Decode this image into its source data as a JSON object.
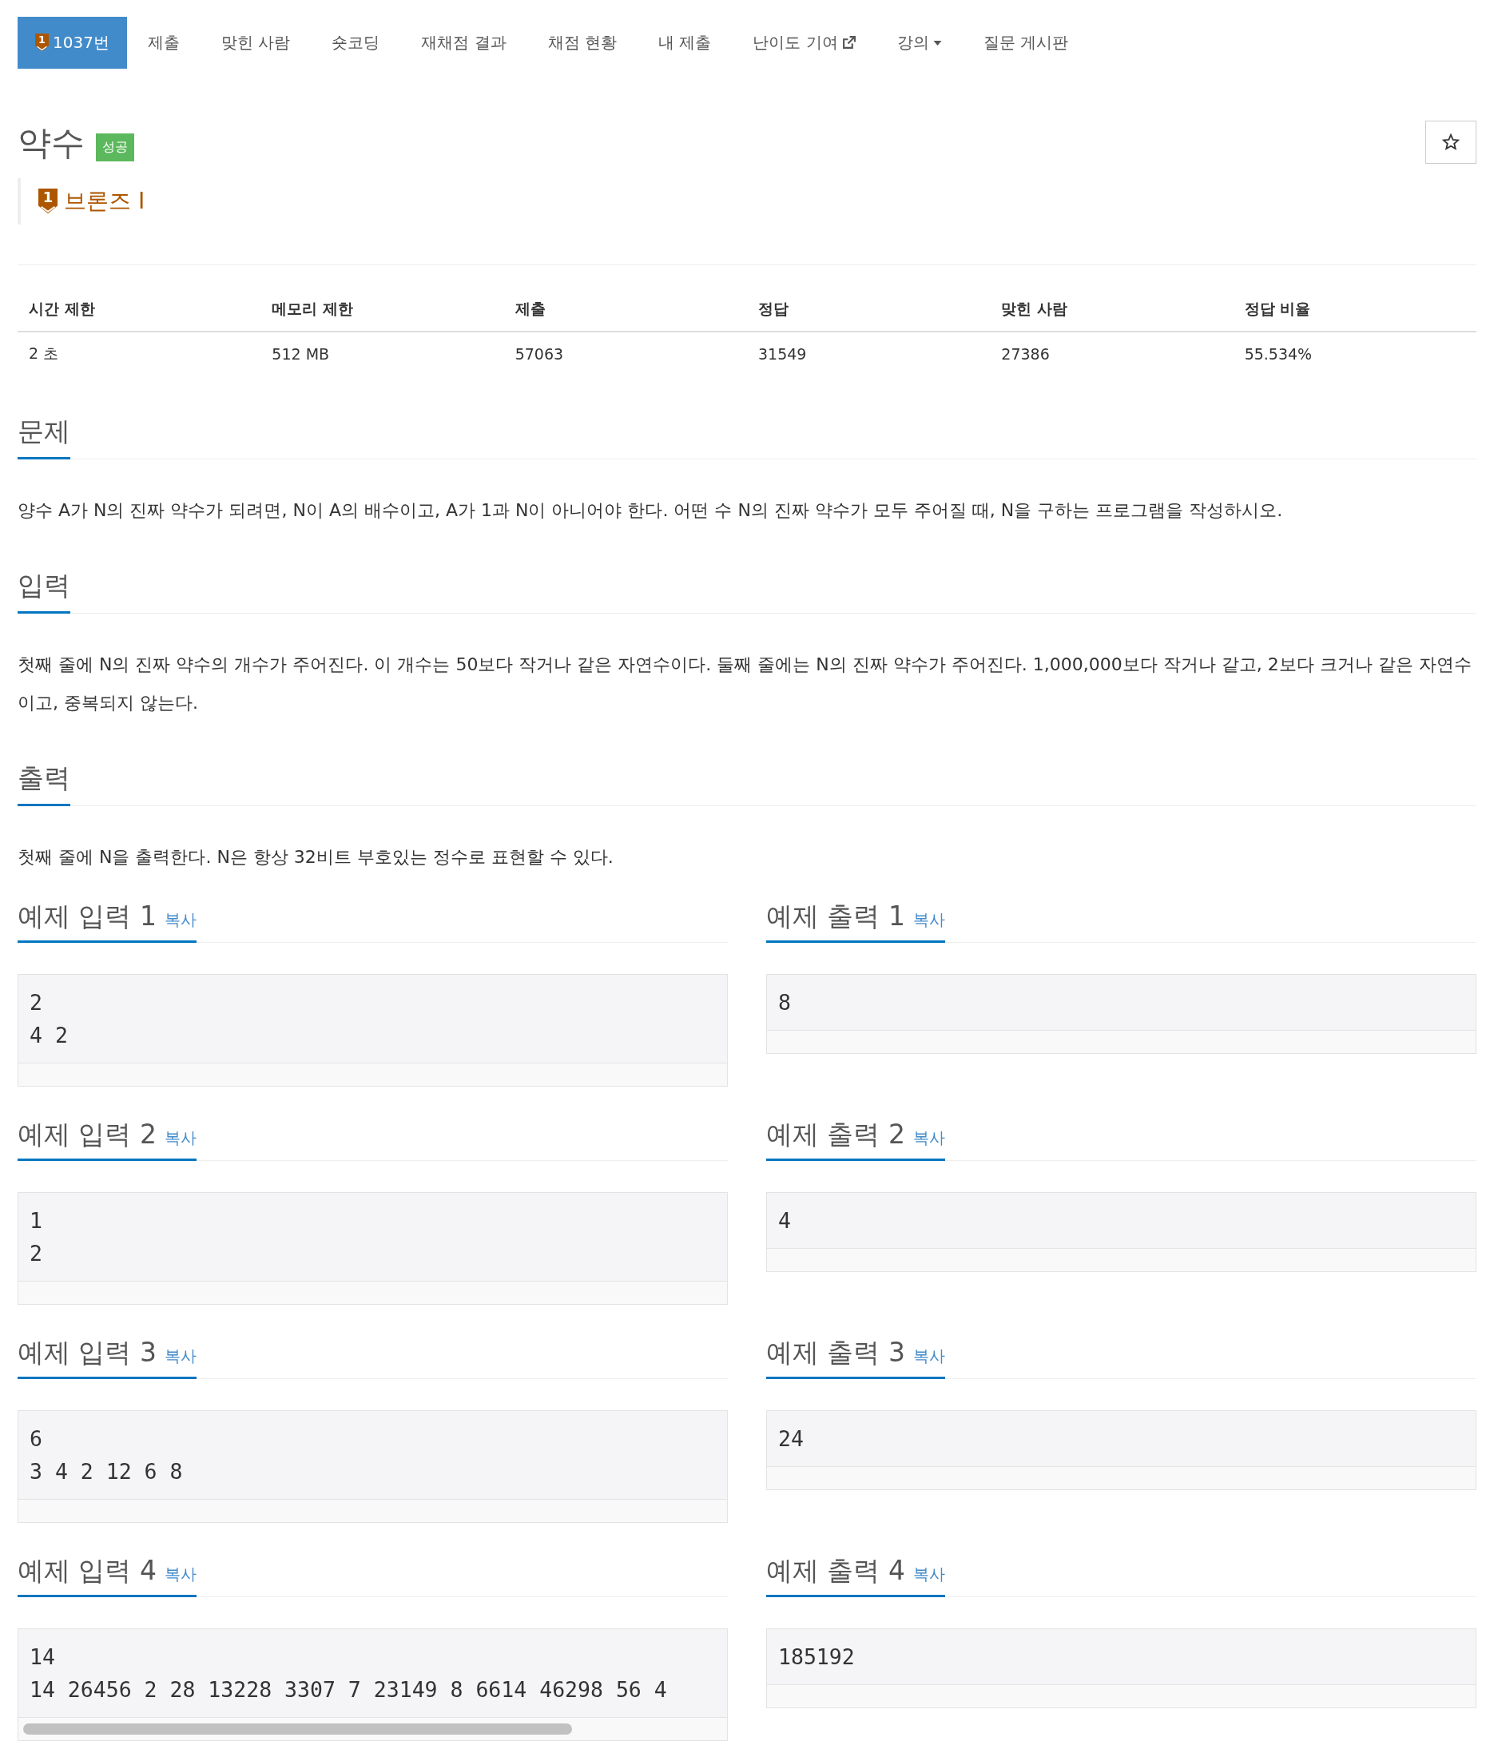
{
  "nav": [
    {
      "label": "1037번",
      "selected": true,
      "kind": "tier",
      "tier": "1"
    },
    {
      "label": "제출",
      "selected": false,
      "kind": "plain"
    },
    {
      "label": "맞힌 사람",
      "selected": false,
      "kind": "plain"
    },
    {
      "label": "숏코딩",
      "selected": false,
      "kind": "plain"
    },
    {
      "label": "재채점 결과",
      "selected": false,
      "kind": "plain"
    },
    {
      "label": "채점 현황",
      "selected": false,
      "kind": "plain"
    },
    {
      "label": "내 제출",
      "selected": false,
      "kind": "plain"
    },
    {
      "label": "난이도 기여",
      "selected": false,
      "kind": "external"
    },
    {
      "label": "강의",
      "selected": false,
      "kind": "dropdown"
    },
    {
      "label": "질문 게시판",
      "selected": false,
      "kind": "plain"
    }
  ],
  "problem": {
    "title": "약수",
    "result": "성공",
    "starred": false,
    "tier": {
      "number": "1",
      "name": "브론즈 I"
    }
  },
  "table": {
    "columns": [
      "시간 제한",
      "메모리 제한",
      "제출",
      "정답",
      "맞힌 사람",
      "정답 비율"
    ],
    "rows": [
      [
        "2 초",
        "512 MB",
        "57063",
        "31549",
        "27386",
        "55.534%"
      ]
    ]
  },
  "sections": [
    {
      "heading": "문제",
      "text": "양수 A가 N의 진짜 약수가 되려면, N이 A의 배수이고, A가 1과 N이 아니어야 한다. 어떤 수 N의 진짜 약수가 모두 주어질 때, N을 구하는 프로그램을 작성하시오."
    },
    {
      "heading": "입력",
      "text": "첫째 줄에 N의 진짜 약수의 개수가 주어진다. 이 개수는 50보다 작거나 같은 자연수이다. 둘째 줄에는 N의 진짜 약수가 주어진다. 1,000,000보다 작거나 같고, 2보다 크거나 같은 자연수이고, 중복되지 않는다."
    },
    {
      "heading": "출력",
      "text": "첫째 줄에 N을 출력한다. N은 항상 32비트 부호있는 정수로 표현할 수 있다."
    }
  ],
  "examples": [
    {
      "input": {
        "heading": "예제 입력 1",
        "copy": "복사",
        "text": "2\n4 2",
        "scrollable": false
      },
      "output": {
        "heading": "예제 출력 1",
        "copy": "복사",
        "text": "8",
        "scrollable": false
      }
    },
    {
      "input": {
        "heading": "예제 입력 2",
        "copy": "복사",
        "text": "1\n2",
        "scrollable": false
      },
      "output": {
        "heading": "예제 출력 2",
        "copy": "복사",
        "text": "4",
        "scrollable": false
      }
    },
    {
      "input": {
        "heading": "예제 입력 3",
        "copy": "복사",
        "text": "6\n3 4 2 12 6 8",
        "scrollable": false
      },
      "output": {
        "heading": "예제 출력 3",
        "copy": "복사",
        "text": "24",
        "scrollable": false
      }
    },
    {
      "input": {
        "heading": "예제 입력 4",
        "copy": "복사",
        "text": "14\n14 26456 2 28 13228 3307 7 23149 8 6614 46298 56 4",
        "scrollable": true
      },
      "output": {
        "heading": "예제 출력 4",
        "copy": "복사",
        "text": "185192",
        "scrollable": false
      }
    }
  ]
}
